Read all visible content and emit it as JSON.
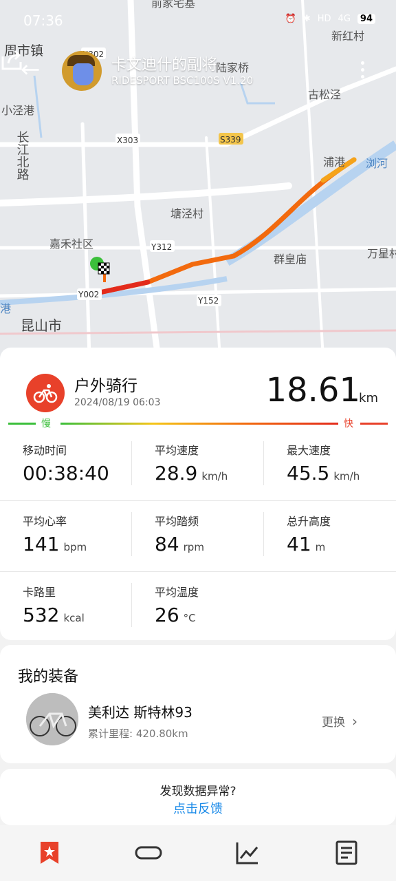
{
  "status": {
    "time": "07:36",
    "hd": "HD",
    "network": "4G",
    "battery": "94"
  },
  "header": {
    "title": "卡文迪什的副将",
    "subtitle": "RIDESPORT BSC100S  V1.20"
  },
  "map": {
    "labels": [
      "前家宅基",
      "周市镇",
      "新红村",
      "X302",
      "陆家桥",
      "古松泾",
      "小泾港",
      "长江北路",
      "X303",
      "S339",
      "浦港",
      "浏河",
      "塘泾村",
      "嘉禾社区",
      "Y312",
      "群皇庙",
      "万星村",
      "Y002",
      "Y152",
      "港",
      "昆山市"
    ]
  },
  "workout": {
    "type": "户外骑行",
    "datetime": "2024/08/19 06:03",
    "distance": "18.61",
    "distance_unit": "km",
    "slow_label": "慢",
    "fast_label": "快"
  },
  "stats": [
    [
      {
        "label": "移动时间",
        "value": "00:38:40",
        "unit": ""
      },
      {
        "label": "平均速度",
        "value": "28.9",
        "unit": "km/h"
      },
      {
        "label": "最大速度",
        "value": "45.5",
        "unit": "km/h"
      }
    ],
    [
      {
        "label": "平均心率",
        "value": "141",
        "unit": "bpm"
      },
      {
        "label": "平均踏频",
        "value": "84",
        "unit": "rpm"
      },
      {
        "label": "总升高度",
        "value": "41",
        "unit": "m"
      }
    ],
    [
      {
        "label": "卡路里",
        "value": "532",
        "unit": "kcal"
      },
      {
        "label": "平均温度",
        "value": "26",
        "unit": "°C"
      }
    ]
  ],
  "gear": {
    "title": "我的装备",
    "bike_name": "美利达 斯特林93",
    "mileage": "累计里程: 420.80km",
    "switch_label": "更换"
  },
  "feedback": {
    "question": "发现数据异常?",
    "link": "点击反馈"
  },
  "colors": {
    "accent": "#e8412a",
    "link": "#1a8ae8",
    "slow": "#3bbf3b",
    "fast": "#e8412a"
  },
  "tabs": [
    "bookmark-icon",
    "ring-icon",
    "chart-icon",
    "report-icon"
  ]
}
